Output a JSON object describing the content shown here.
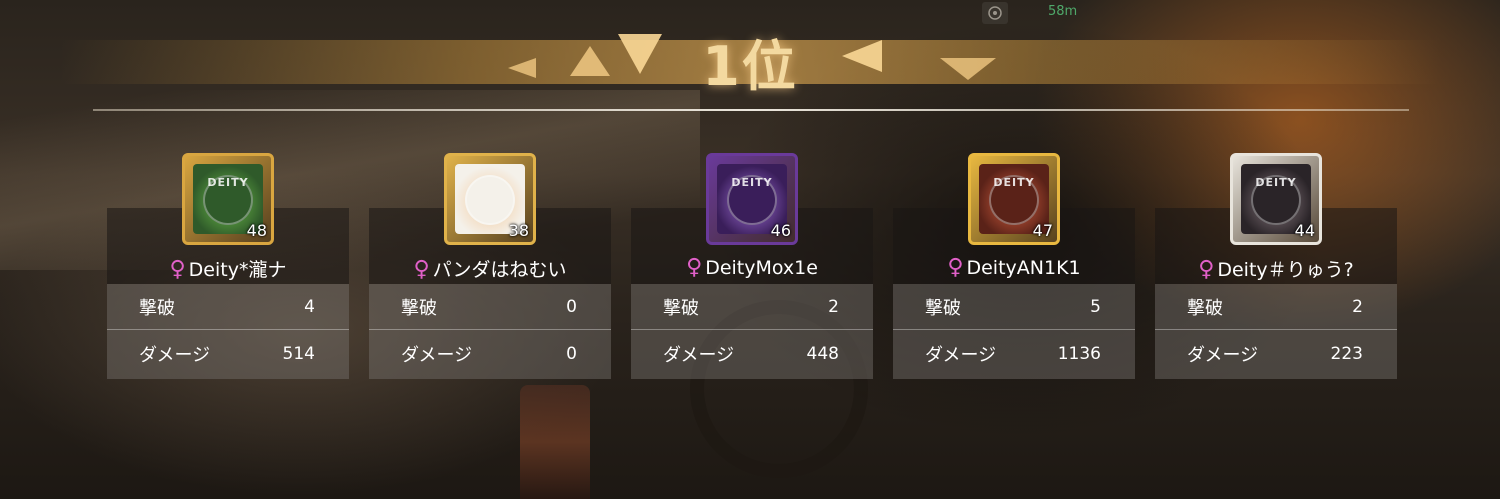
{
  "hud": {
    "compass_icon": "compass-icon",
    "distance": "58m"
  },
  "rank": {
    "text": "1位"
  },
  "colors": {
    "accent_gold": "#f3d9a0",
    "gender_pink": "#e060c8",
    "distance_green": "#4fa86a"
  },
  "players": [
    {
      "name": "Deity*瀧ナ",
      "level": "48",
      "gender_icon": "female-icon",
      "stats": [
        {
          "label": "撃破",
          "value": "4"
        },
        {
          "label": "ダメージ",
          "value": "514"
        }
      ],
      "avatar": {
        "frame": "#d9a640",
        "bg": "#2f5a2a",
        "emblem": "#6fc04a",
        "label": "DEITY"
      }
    },
    {
      "name": "パンダはねむい",
      "level": "38",
      "gender_icon": "female-icon",
      "stats": [
        {
          "label": "撃破",
          "value": "0"
        },
        {
          "label": "ダメージ",
          "value": "0"
        }
      ],
      "avatar": {
        "frame": "#e0b24a",
        "bg": "#f4f1ea",
        "emblem": "#f2c89a",
        "label": ""
      }
    },
    {
      "name": "DeityMox1e",
      "level": "46",
      "gender_icon": "female-icon",
      "stats": [
        {
          "label": "撃破",
          "value": "2"
        },
        {
          "label": "ダメージ",
          "value": "448"
        }
      ],
      "avatar": {
        "frame": "#6a3a9a",
        "bg": "#3a1e5a",
        "emblem": "#a070d8",
        "label": "DEITY"
      }
    },
    {
      "name": "DeityAN1K1",
      "level": "47",
      "gender_icon": "female-icon",
      "stats": [
        {
          "label": "撃破",
          "value": "5"
        },
        {
          "label": "ダメージ",
          "value": "1136"
        }
      ],
      "avatar": {
        "frame": "#e8b840",
        "bg": "#5a2218",
        "emblem": "#d86040",
        "label": "DEITY"
      }
    },
    {
      "name": "Deity＃りゅう?",
      "level": "44",
      "gender_icon": "female-icon",
      "stats": [
        {
          "label": "撃破",
          "value": "2"
        },
        {
          "label": "ダメージ",
          "value": "223"
        }
      ],
      "avatar": {
        "frame": "#e8e4dc",
        "bg": "#2a2428",
        "emblem": "#8a7a80",
        "label": "DEITY"
      }
    }
  ]
}
